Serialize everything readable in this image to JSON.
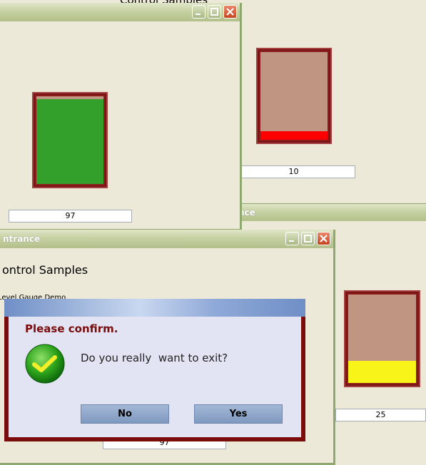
{
  "window_top_left": {
    "title": "",
    "gauge": {
      "level_percent": 97,
      "fill_color": "#33a02c",
      "value": "97"
    }
  },
  "window_top_right": {
    "gauge": {
      "level_percent": 10,
      "fill_color": "#ff0000",
      "value": "10"
    }
  },
  "window_middle": {
    "title_fragment": "nce"
  },
  "window_front": {
    "title": "ntrance",
    "heading": "ontrol Samples",
    "subheading": "Level Gauge Demo",
    "value_field": "97"
  },
  "window_right": {
    "gauge": {
      "level_percent": 25,
      "fill_color": "#f8f318",
      "value": "25"
    }
  },
  "top_clip_text": "Control Samples",
  "dialog": {
    "title": "Please confirm.",
    "message": "Do you really  want to exit?",
    "no_label": "No",
    "yes_label": "Yes",
    "icon": "checkmark-icon"
  },
  "colors": {
    "dialog_border": "#7a0c0c",
    "dialog_title": "#7a0c0c",
    "gauge_frame": "#8b1d1d"
  }
}
